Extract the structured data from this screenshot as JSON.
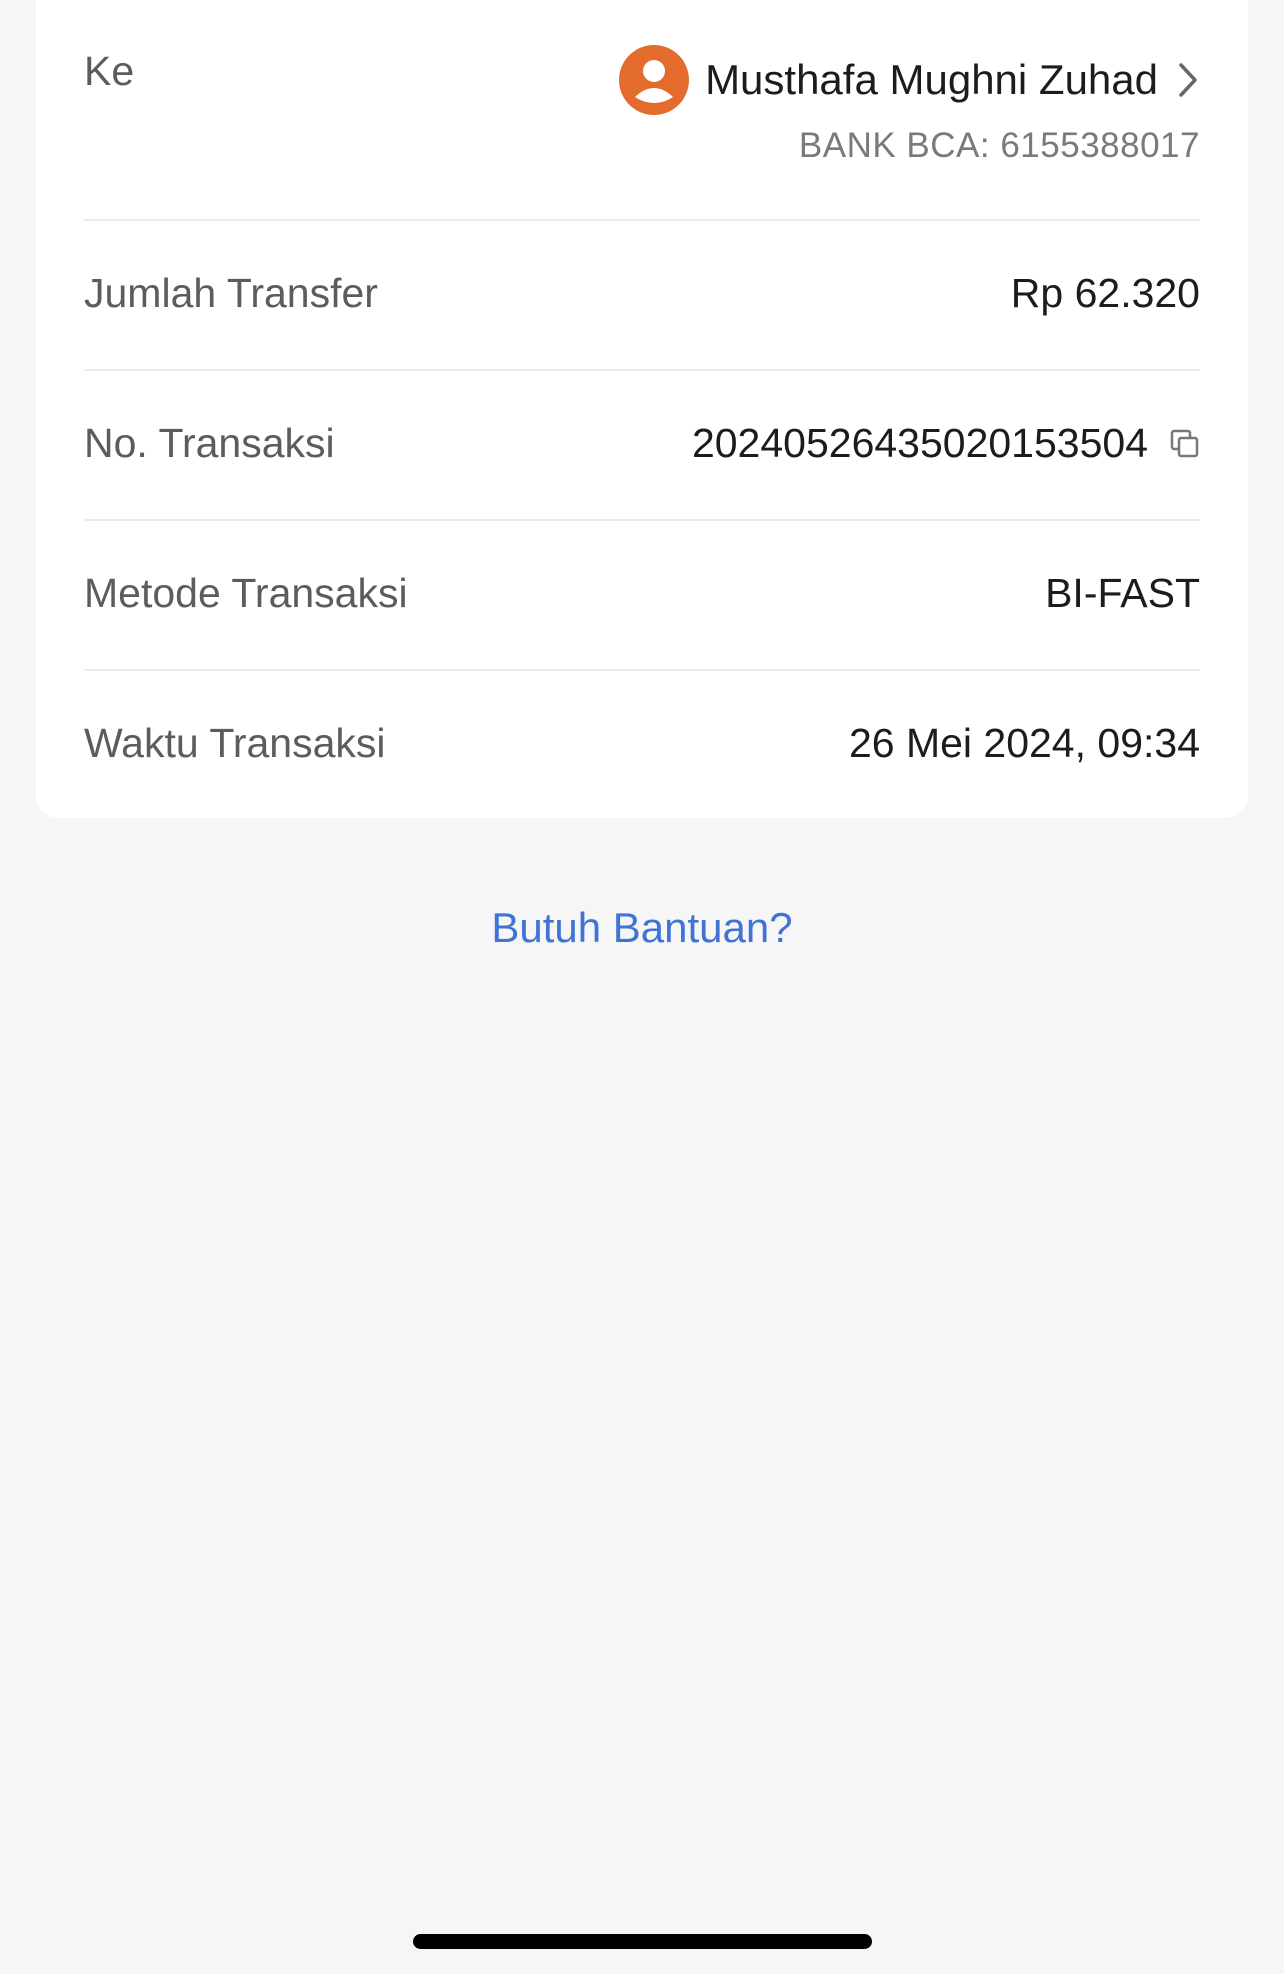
{
  "recipient": {
    "label": "Ke",
    "name": "Musthafa Mughni Zuhad",
    "bank_account": "BANK BCA: 6155388017",
    "avatar_icon": "person-avatar-icon",
    "avatar_color": "#e36c2c"
  },
  "details": {
    "amount_label": "Jumlah Transfer",
    "amount_value": "Rp 62.320",
    "txid_label": "No. Transaksi",
    "txid_value": "20240526435020153504",
    "method_label": "Metode Transaksi",
    "method_value": "BI-FAST",
    "time_label": "Waktu Transaksi",
    "time_value": "26 Mei 2024, 09:34"
  },
  "help": {
    "link_text": "Butuh Bantuan?",
    "link_color": "#3f73d6"
  }
}
